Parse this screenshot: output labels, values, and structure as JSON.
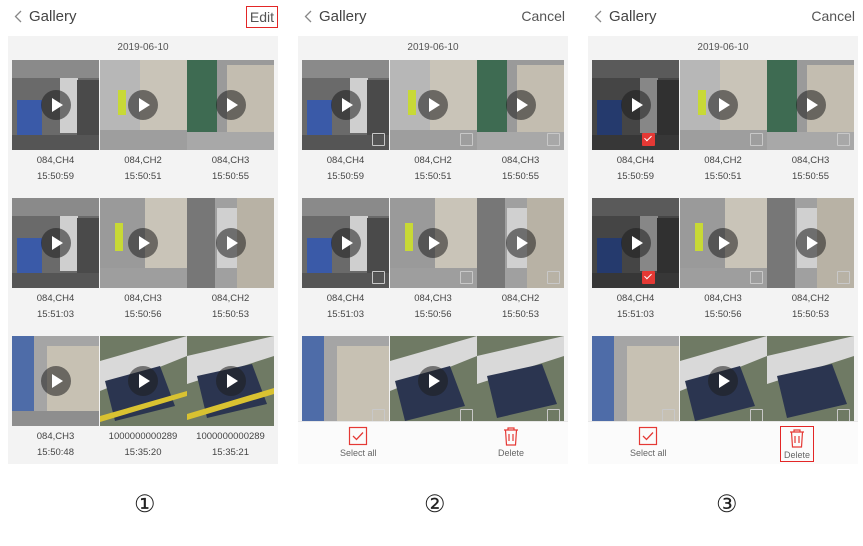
{
  "panels": [
    {
      "title": "Gallery",
      "action": "Edit",
      "date": "2019-06-10",
      "items": [
        {
          "channel": "084,CH4",
          "time": "15:50:59"
        },
        {
          "channel": "084,CH2",
          "time": "15:50:51"
        },
        {
          "channel": "084,CH3",
          "time": "15:50:55"
        },
        {
          "channel": "084,CH4",
          "time": "15:51:03"
        },
        {
          "channel": "084,CH3",
          "time": "15:50:56"
        },
        {
          "channel": "084,CH2",
          "time": "15:50:53"
        },
        {
          "channel": "084,CH3",
          "time": "15:50:48"
        },
        {
          "channel": "1000000000289",
          "time": "15:35:20"
        },
        {
          "channel": "1000000000289",
          "time": "15:35:21"
        }
      ],
      "step_label": "①"
    },
    {
      "title": "Gallery",
      "action": "Cancel",
      "date": "2019-06-10",
      "items": [
        {
          "channel": "084,CH4",
          "time": "15:50:59"
        },
        {
          "channel": "084,CH2",
          "time": "15:50:51"
        },
        {
          "channel": "084,CH3",
          "time": "15:50:55"
        },
        {
          "channel": "084,CH4",
          "time": "15:51:03"
        },
        {
          "channel": "084,CH3",
          "time": "15:50:56"
        },
        {
          "channel": "084,CH2",
          "time": "15:50:53"
        }
      ],
      "select_all_label": "Select all",
      "delete_label": "Delete",
      "step_label": "②"
    },
    {
      "title": "Gallery",
      "action": "Cancel",
      "date": "2019-06-10",
      "items": [
        {
          "channel": "084,CH4",
          "time": "15:50:59",
          "checked": true
        },
        {
          "channel": "084,CH2",
          "time": "15:50:51",
          "checked": false
        },
        {
          "channel": "084,CH3",
          "time": "15:50:55",
          "checked": false
        },
        {
          "channel": "084,CH4",
          "time": "15:51:03",
          "checked": true
        },
        {
          "channel": "084,CH3",
          "time": "15:50:56",
          "checked": false
        },
        {
          "channel": "084,CH2",
          "time": "15:50:53",
          "checked": false
        }
      ],
      "select_all_label": "Select all",
      "delete_label": "Delete",
      "step_label": "③"
    }
  ],
  "colors": {
    "highlight": "#e32626",
    "checked": "#e53935"
  }
}
